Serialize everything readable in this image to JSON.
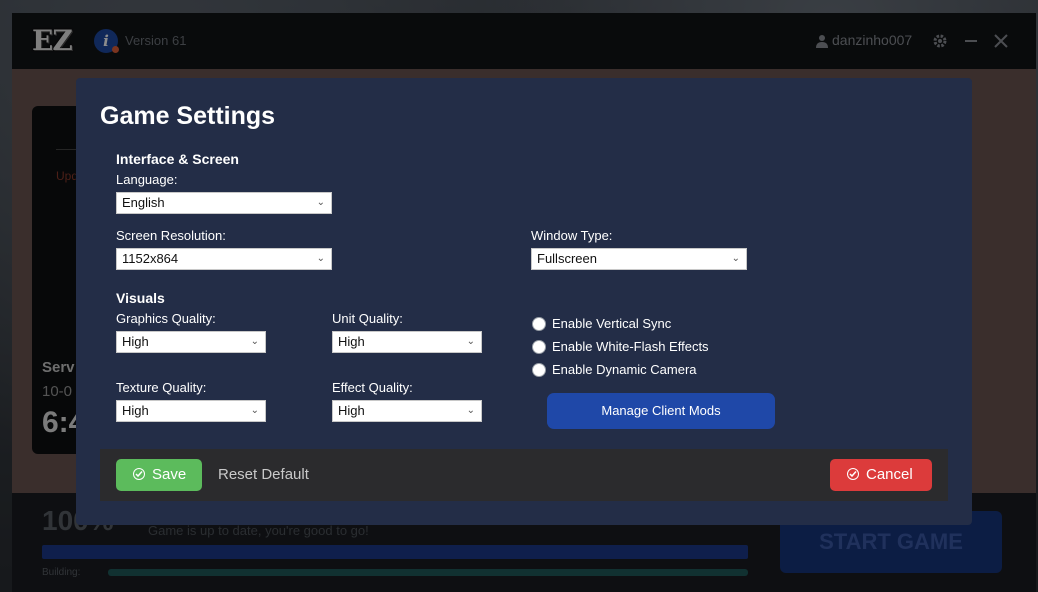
{
  "app": {
    "logo_text": "EZ",
    "version": "Version 61",
    "username": "danzinho007"
  },
  "background": {
    "server_update": "Upd",
    "server_label": "Serv",
    "server_date": "10-0",
    "server_time": "6:4",
    "progress_percent": "100%",
    "status_text": "Game is up to date, you're good to go!",
    "building_label": "Building:",
    "start_button": "START GAME"
  },
  "modal": {
    "title": "Game Settings",
    "interface_section": "Interface & Screen",
    "language_label": "Language:",
    "language_value": "English",
    "resolution_label": "Screen Resolution:",
    "resolution_value": "1152x864",
    "window_type_label": "Window Type:",
    "window_type_value": "Fullscreen",
    "visuals_section": "Visuals",
    "graphics_label": "Graphics Quality:",
    "graphics_value": "High",
    "unit_label": "Unit Quality:",
    "unit_value": "High",
    "texture_label": "Texture Quality:",
    "texture_value": "High",
    "effect_label": "Effect Quality:",
    "effect_value": "High",
    "options": [
      {
        "label": "Enable Vertical Sync",
        "checked": false
      },
      {
        "label": "Enable White-Flash Effects",
        "checked": false
      },
      {
        "label": "Enable Dynamic Camera",
        "checked": false
      }
    ],
    "manage_mods": "Manage Client Mods",
    "save": "Save",
    "reset": "Reset Default",
    "cancel": "Cancel"
  },
  "colors": {
    "modal_bg": "#232d47",
    "save_green": "#5cbb5c",
    "cancel_red": "#dc3b3b",
    "mods_blue": "#1f48a8"
  }
}
